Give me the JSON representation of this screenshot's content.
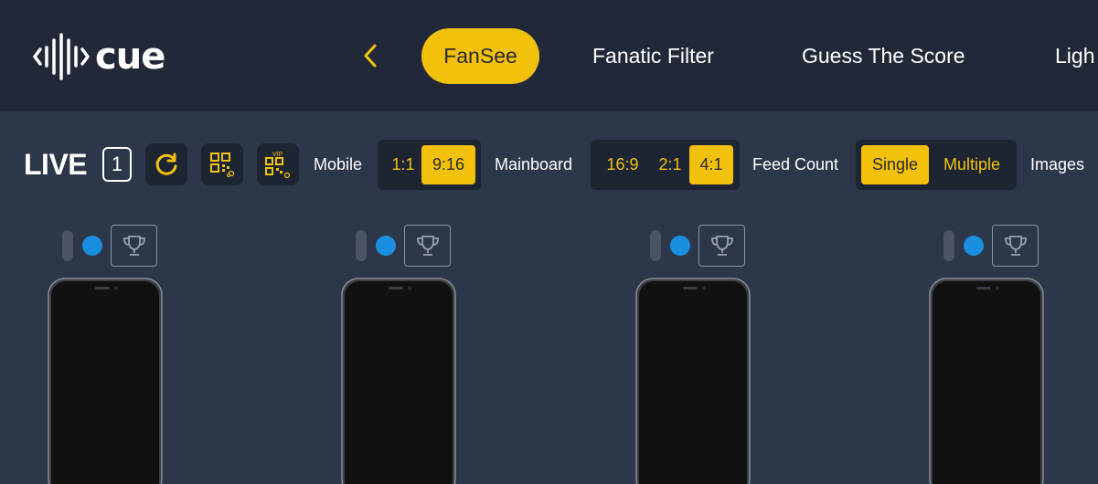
{
  "brand": {
    "name": "cue"
  },
  "nav": {
    "back_icon": "chevron-left-icon",
    "tabs": [
      {
        "label": "FanSee",
        "active": true
      },
      {
        "label": "Fanatic Filter",
        "active": false
      },
      {
        "label": "Guess The Score",
        "active": false
      },
      {
        "label": "Ligh",
        "active": false
      }
    ]
  },
  "toolbar": {
    "live_label": "LIVE",
    "live_count": "1",
    "refresh_icon": "refresh-icon",
    "qr_icon": "qr-code-icon",
    "vip_qr_icon": "vip-qr-code-icon",
    "mobile": {
      "label": "Mobile",
      "options": [
        "1:1",
        "9:16"
      ],
      "selected": "9:16"
    },
    "mainboard": {
      "label": "Mainboard",
      "options": [
        "16:9",
        "2:1",
        "4:1"
      ],
      "selected": "4:1"
    },
    "feed_count": {
      "label": "Feed Count",
      "options": [
        "Single",
        "Multiple"
      ],
      "selected": "Single"
    },
    "images": {
      "label": "Images"
    }
  },
  "devices": [
    {
      "status_icon": "status-dot-icon",
      "award_icon": "trophy-icon"
    },
    {
      "status_icon": "status-dot-icon",
      "award_icon": "trophy-icon"
    },
    {
      "status_icon": "status-dot-icon",
      "award_icon": "trophy-icon"
    },
    {
      "status_icon": "status-dot-icon",
      "award_icon": "trophy-icon"
    }
  ],
  "colors": {
    "header_bg": "#212939",
    "page_bg": "#2c374a",
    "accent": "#f2c10c",
    "status_blue": "#1a8fe0"
  }
}
